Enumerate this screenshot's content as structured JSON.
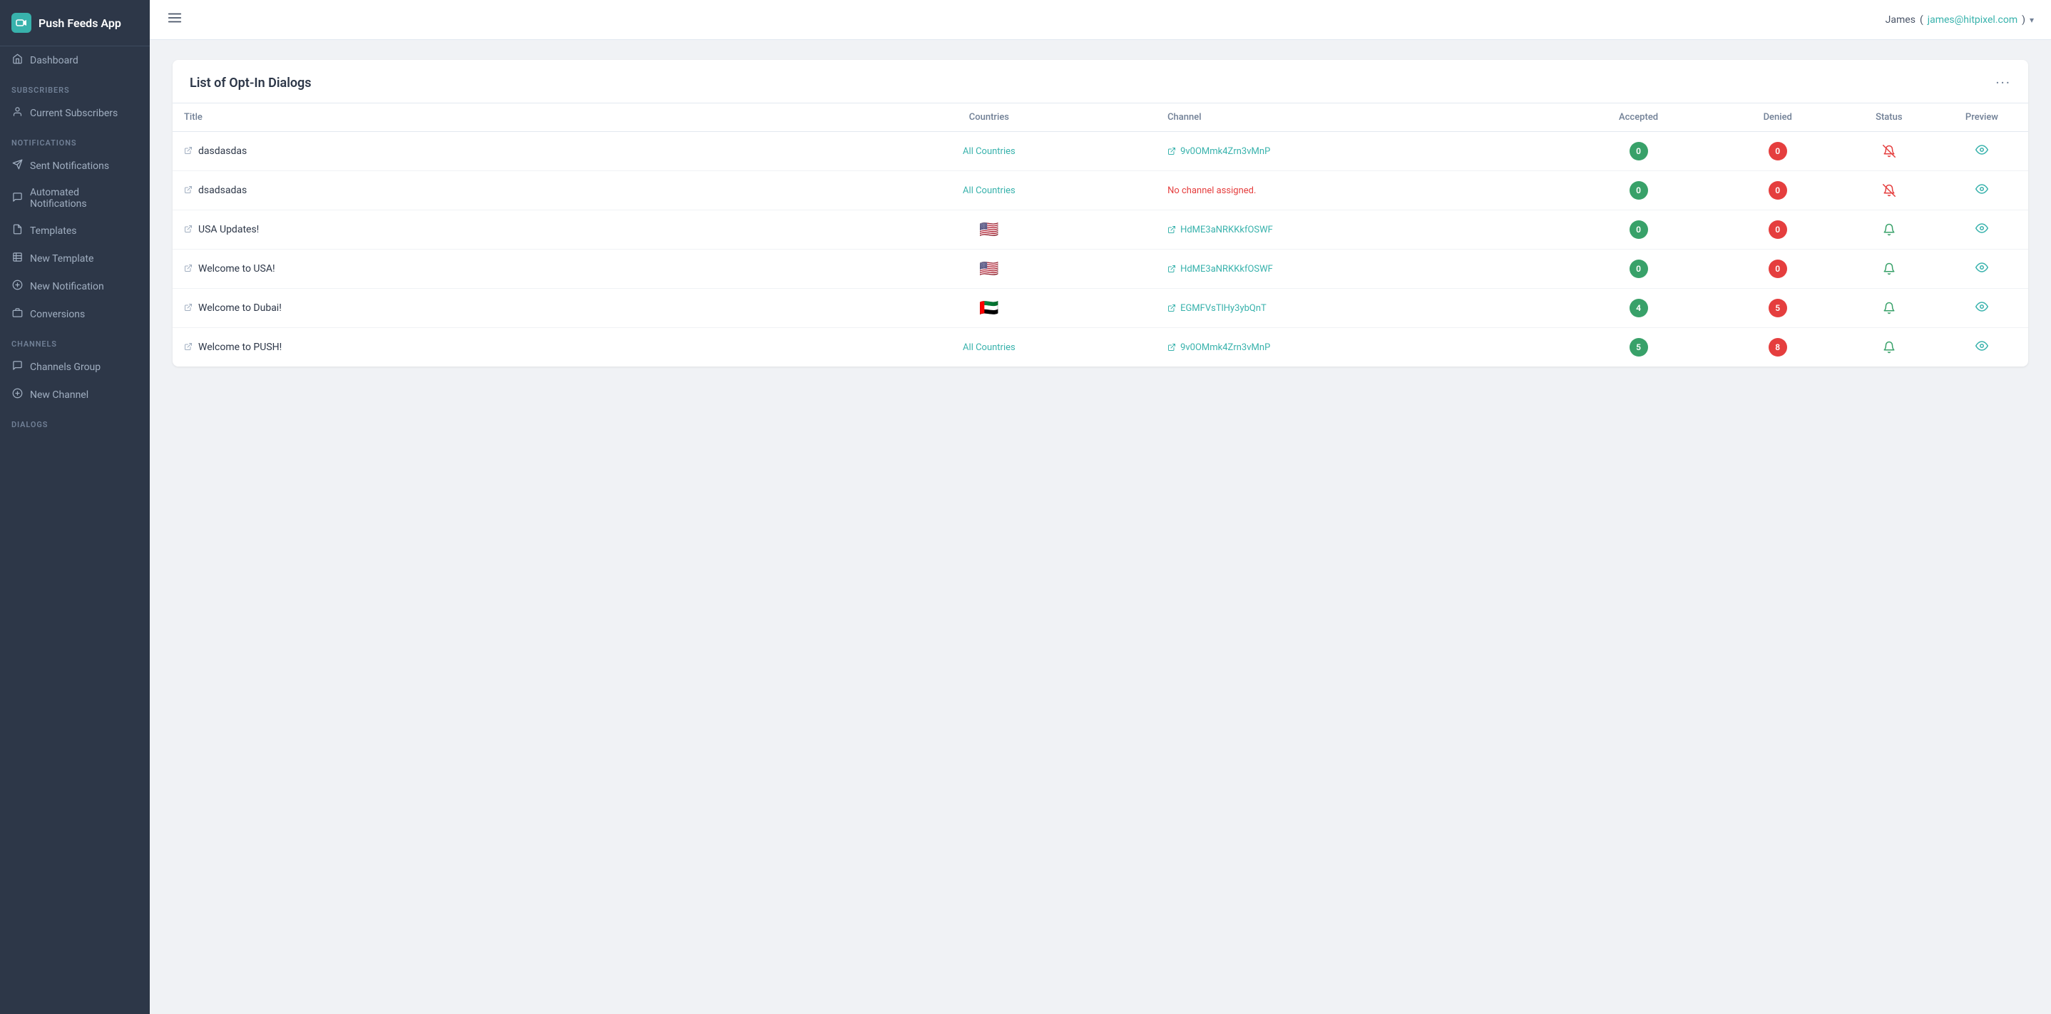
{
  "app": {
    "name": "Push Feeds App"
  },
  "topbar": {
    "user_name": "James",
    "user_email": "james@hitpixel.com"
  },
  "sidebar": {
    "sections": [
      {
        "label": "",
        "items": [
          {
            "id": "dashboard",
            "label": "Dashboard",
            "icon": "🏠"
          }
        ]
      },
      {
        "label": "Subscribers",
        "items": [
          {
            "id": "current-subscribers",
            "label": "Current Subscribers",
            "icon": "👤"
          }
        ]
      },
      {
        "label": "Notifications",
        "items": [
          {
            "id": "sent-notifications",
            "label": "Sent Notifications",
            "icon": "✈"
          },
          {
            "id": "automated-notifications",
            "label": "Automated Notifications",
            "icon": "💬"
          },
          {
            "id": "templates",
            "label": "Templates",
            "icon": "📄"
          },
          {
            "id": "new-template",
            "label": "New Template",
            "icon": "📋"
          },
          {
            "id": "new-notification",
            "label": "New Notification",
            "icon": "➕"
          },
          {
            "id": "conversions",
            "label": "Conversions",
            "icon": "🎁"
          }
        ]
      },
      {
        "label": "Channels",
        "items": [
          {
            "id": "channels-group",
            "label": "Channels Group",
            "icon": "💬"
          },
          {
            "id": "new-channel",
            "label": "New Channel",
            "icon": "➕"
          }
        ]
      },
      {
        "label": "Dialogs",
        "items": []
      }
    ]
  },
  "page": {
    "title": "List of Opt-In Dialogs"
  },
  "table": {
    "columns": [
      "Title",
      "Countries",
      "Channel",
      "Accepted",
      "Denied",
      "Status",
      "Preview"
    ],
    "rows": [
      {
        "title": "dasdasdas",
        "countries": "All Countries",
        "countries_type": "all",
        "channel": "9v0OMmk4Zrn3vMnP",
        "channel_type": "link",
        "accepted": 0,
        "denied": 0,
        "status": "inactive",
        "flag": ""
      },
      {
        "title": "dsadsadas",
        "countries": "All Countries",
        "countries_type": "all",
        "channel": "No channel assigned.",
        "channel_type": "none",
        "accepted": 0,
        "denied": 0,
        "status": "inactive",
        "flag": ""
      },
      {
        "title": "USA Updates!",
        "countries": "🇺🇸",
        "countries_type": "flag",
        "channel": "HdME3aNRKKkfOSWF",
        "channel_type": "link",
        "accepted": 0,
        "denied": 0,
        "status": "active",
        "flag": "🇺🇸"
      },
      {
        "title": "Welcome to USA!",
        "countries": "🇺🇸",
        "countries_type": "flag",
        "channel": "HdME3aNRKKkfOSWF",
        "channel_type": "link",
        "accepted": 0,
        "denied": 0,
        "status": "active",
        "flag": "🇺🇸"
      },
      {
        "title": "Welcome to Dubai!",
        "countries": "🇦🇪",
        "countries_type": "flag",
        "channel": "EGMFVsTlHy3ybQnT",
        "channel_type": "link",
        "accepted": 4,
        "denied": 5,
        "status": "active",
        "flag": "🇦🇪"
      },
      {
        "title": "Welcome to PUSH!",
        "countries": "All Countries",
        "countries_type": "all",
        "channel": "9v0OMmk4Zrn3vMnP",
        "channel_type": "link",
        "accepted": 5,
        "denied": 8,
        "status": "active",
        "flag": ""
      }
    ]
  }
}
